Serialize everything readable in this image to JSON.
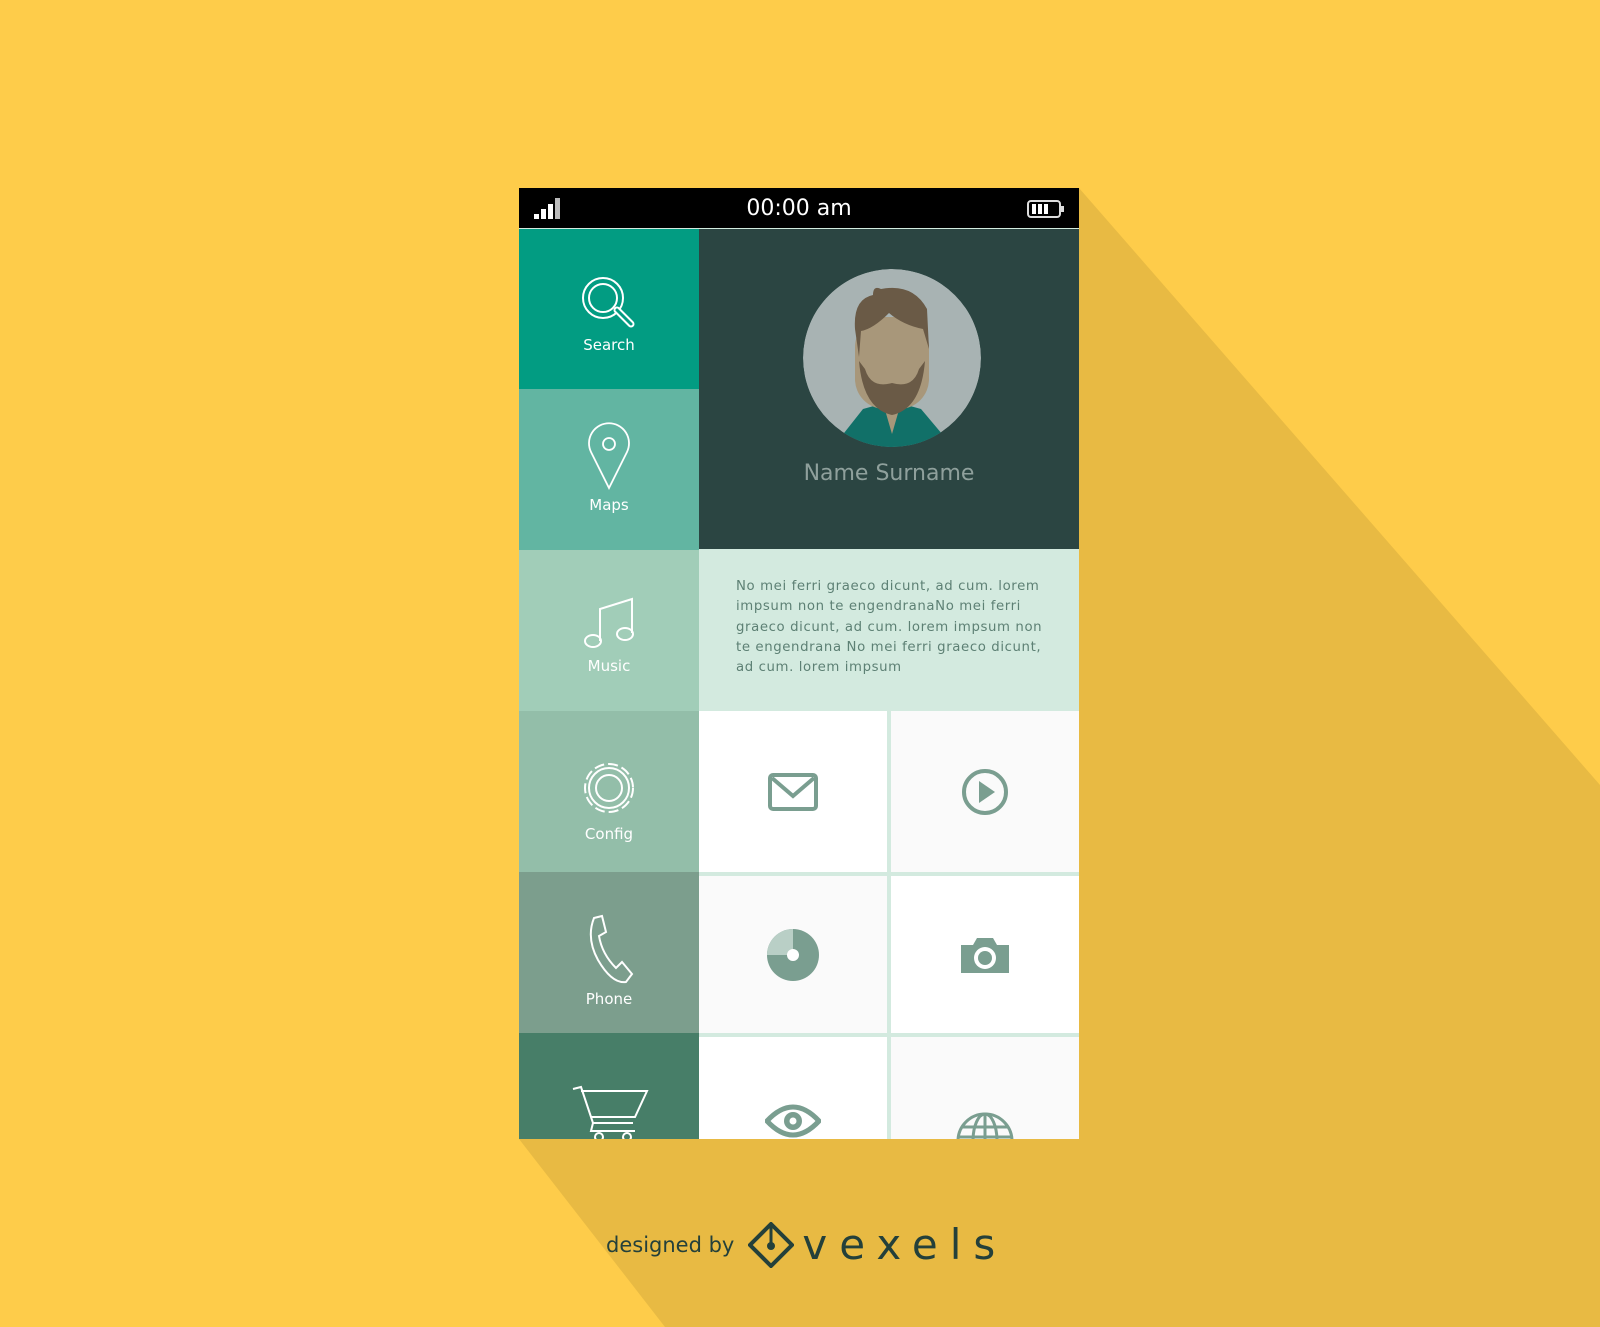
{
  "status_bar": {
    "time": "00:00 am",
    "signal_icon": "signal-bars-icon",
    "battery_icon": "battery-icon"
  },
  "sidebar": {
    "items": [
      {
        "label": "Search",
        "icon": "search-icon",
        "color": "#029C82"
      },
      {
        "label": "Maps",
        "icon": "map-pin-icon",
        "color": "#62B5A2"
      },
      {
        "label": "Music",
        "icon": "music-note-icon",
        "color": "#A1CDB8"
      },
      {
        "label": "Config",
        "icon": "gear-icon",
        "color": "#93BEA9"
      },
      {
        "label": "Phone",
        "icon": "phone-icon",
        "color": "#7C9E8D"
      },
      {
        "label": "",
        "icon": "cart-icon",
        "color": "#477E68"
      }
    ]
  },
  "profile": {
    "name": "Name Surname",
    "avatar": "avatar-man-beard"
  },
  "description": "No mei ferri graeco dicunt, ad cum. lorem impsum non te engendranaNo mei ferri graeco dicunt, ad cum. lorem impsum non te engendrana No mei ferri graeco dicunt, ad cum. lorem impsum",
  "grid": {
    "icons": [
      "mail-icon",
      "play-icon",
      "disc-icon",
      "camera-icon",
      "eye-icon",
      "globe-icon"
    ]
  },
  "colors": {
    "background": "#FECC4A",
    "shadow": "#E8BA43",
    "icon": "#7A9E90"
  },
  "footer": {
    "designed_by": "designed by",
    "brand": "vexels"
  }
}
